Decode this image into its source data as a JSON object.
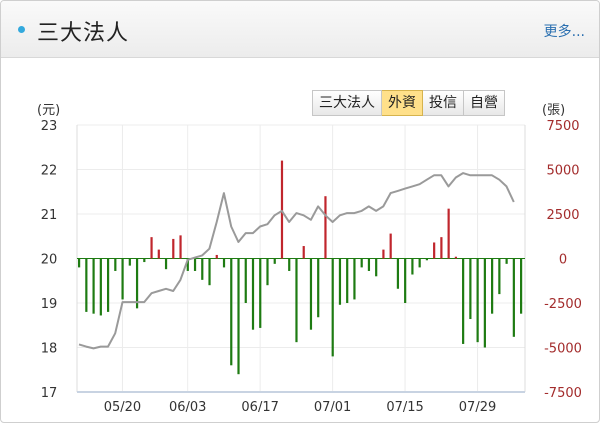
{
  "header": {
    "title": "三大法人",
    "more_label": "更多..."
  },
  "tabs": [
    {
      "label": "三大法人",
      "active": false
    },
    {
      "label": "外資",
      "active": true
    },
    {
      "label": "投信",
      "active": false
    },
    {
      "label": "自營",
      "active": false
    }
  ],
  "colors": {
    "positive": "#c0262d",
    "negative": "#1e7b12",
    "price_line": "#9a9a9a",
    "left_axis": "#333333",
    "right_axis": "#a32c2c"
  },
  "chart_data": {
    "type": "bar",
    "left_axis": {
      "unit_label": "(元)",
      "min": 17,
      "max": 23,
      "ticks": [
        23,
        22,
        21,
        20,
        19,
        18,
        17
      ]
    },
    "right_axis": {
      "unit_label": "(張)",
      "min": -7500,
      "max": 7500,
      "ticks": [
        7500,
        5000,
        2500,
        0,
        -2500,
        -5000,
        -7500
      ]
    },
    "x_tick_labels": [
      "05/20",
      "06/03",
      "06/17",
      "07/01",
      "07/15",
      "07/29"
    ],
    "x_tick_index": [
      6,
      15,
      25,
      35,
      45,
      55
    ],
    "bars": [
      -500,
      -3000,
      -3100,
      -3200,
      -3000,
      -700,
      -2300,
      -400,
      -2800,
      -200,
      1200,
      500,
      -600,
      1100,
      1300,
      -700,
      -700,
      -1200,
      -1500,
      200,
      -500,
      -6000,
      -6500,
      -2500,
      -4000,
      -3900,
      -1500,
      -300,
      5500,
      -700,
      -4700,
      700,
      -4000,
      -3300,
      3500,
      -5500,
      -2600,
      -2500,
      -2300,
      -500,
      -700,
      -1000,
      500,
      1400,
      -1700,
      -2500,
      -900,
      -500,
      -100,
      900,
      1200,
      2800,
      100,
      -4800,
      -3400,
      -4700,
      -5000,
      -3100,
      -2000,
      -300,
      -4400,
      -3100
    ],
    "price_series": [
      18.07,
      18.02,
      17.98,
      18.02,
      18.02,
      18.32,
      19.02,
      19.02,
      19.02,
      19.02,
      19.22,
      19.27,
      19.32,
      19.27,
      19.52,
      19.97,
      20.02,
      20.07,
      20.22,
      20.82,
      21.47,
      20.72,
      20.37,
      20.57,
      20.57,
      20.72,
      20.77,
      20.97,
      21.07,
      20.82,
      21.02,
      20.97,
      20.87,
      21.17,
      20.97,
      20.82,
      20.97,
      21.02,
      21.02,
      21.07,
      21.17,
      21.07,
      21.17,
      21.47,
      21.52,
      21.57,
      21.62,
      21.67,
      21.77,
      21.87,
      21.87,
      21.62,
      21.82,
      21.92,
      21.87,
      21.87,
      21.87,
      21.87,
      21.77,
      21.62,
      21.27
    ]
  }
}
